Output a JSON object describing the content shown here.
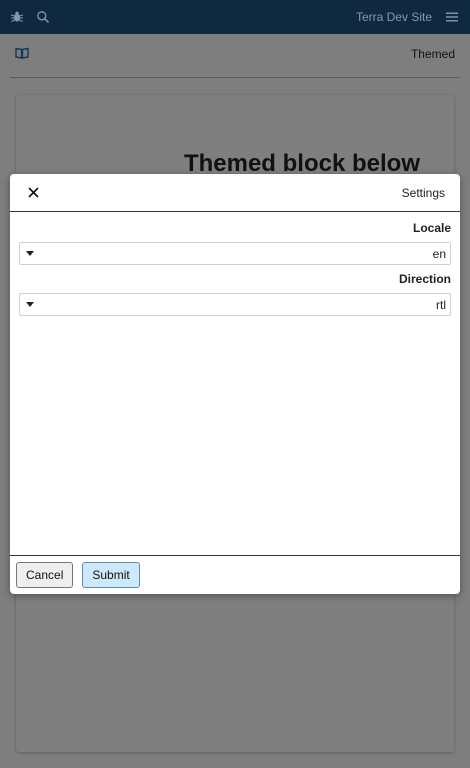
{
  "topbar": {
    "site_name": "Terra Dev Site",
    "icons": [
      "bug-icon",
      "search-icon",
      "hamburger-menu-icon"
    ]
  },
  "subheader": {
    "label": "Themed",
    "icon": "book-icon"
  },
  "page": {
    "heading": "Themed block below"
  },
  "modal": {
    "title": "Settings",
    "fields": [
      {
        "label": "Locale",
        "value": "en"
      },
      {
        "label": "Direction",
        "value": "rtl"
      }
    ],
    "cancel_label": "Cancel",
    "submit_label": "Submit"
  },
  "colors": {
    "topbar_bg": "#0f2a40",
    "overlay": "#7e7e7e",
    "primary_button": "#cde8f8"
  }
}
